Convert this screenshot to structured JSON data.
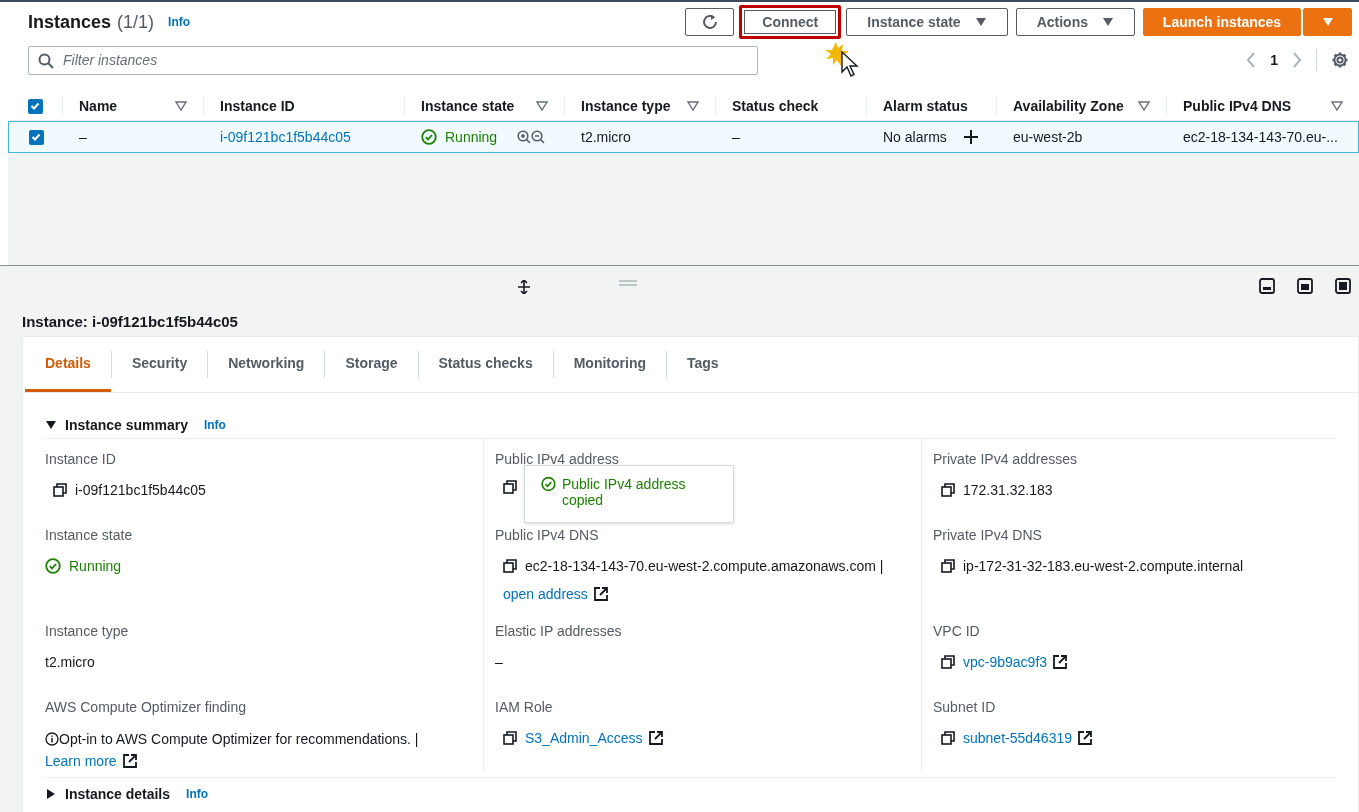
{
  "header": {
    "title": "Instances",
    "count": "(1/1)",
    "info": "Info"
  },
  "toolbar": [
    {
      "kind": "refresh",
      "highlighted": false
    },
    {
      "kind": "normal",
      "label": "Connect",
      "dropdown": false,
      "highlighted": true
    },
    {
      "kind": "normal",
      "label": "Instance state",
      "dropdown": true,
      "highlighted": false
    },
    {
      "kind": "normal",
      "label": "Actions",
      "dropdown": true,
      "highlighted": false
    },
    {
      "kind": "primary",
      "label": "Launch instances",
      "dropdown": false,
      "highlighted": false
    },
    {
      "kind": "primary_caret",
      "highlighted": false
    }
  ],
  "filter": {
    "placeholder": "Filter instances"
  },
  "pagination": {
    "page": "1"
  },
  "table": {
    "all_selected": true,
    "columns": [
      {
        "label": "Name",
        "sortable": true
      },
      {
        "label": "Instance ID",
        "sortable": false
      },
      {
        "label": "Instance state",
        "sortable": true
      },
      {
        "label": "Instance type",
        "sortable": true
      },
      {
        "label": "Status check",
        "sortable": false
      },
      {
        "label": "Alarm status",
        "sortable": false
      },
      {
        "label": "Availability Zone",
        "sortable": true
      },
      {
        "label": "Public IPv4 DNS",
        "sortable": true
      }
    ],
    "rows": [
      {
        "selected": true,
        "cells": [
          {
            "kind": "text",
            "text": "–"
          },
          {
            "kind": "link",
            "text": "i-09f121bc1f5b44c05"
          },
          {
            "kind": "status",
            "text": "Running"
          },
          {
            "kind": "text",
            "text": "t2.micro"
          },
          {
            "kind": "text",
            "text": "–"
          },
          {
            "kind": "alarm",
            "text": "No alarms"
          },
          {
            "kind": "text",
            "text": "eu-west-2b"
          },
          {
            "kind": "text",
            "text": "ec2-18-134-143-70.eu-..."
          }
        ]
      }
    ]
  },
  "details": {
    "title": "Instance: i-09f121bc1f5b44c05",
    "tabs": [
      {
        "label": "Details",
        "selected": true
      },
      {
        "label": "Security",
        "selected": false
      },
      {
        "label": "Networking",
        "selected": false
      },
      {
        "label": "Storage",
        "selected": false
      },
      {
        "label": "Status checks",
        "selected": false
      },
      {
        "label": "Monitoring",
        "selected": false
      },
      {
        "label": "Tags",
        "selected": false
      }
    ],
    "summary": {
      "title": "Instance summary",
      "info": "Info",
      "expanded": true
    },
    "fields": [
      {
        "label": "Instance ID",
        "kind": "copy",
        "text": "i-09f121bc1f5b44c05"
      },
      {
        "label": "Public IPv4 address",
        "kind": "copy",
        "tooltip": "Public IPv4 address copied"
      },
      {
        "label": "Private IPv4 addresses",
        "kind": "copy",
        "text": "172.31.32.183"
      },
      {
        "label": "Instance state",
        "kind": "status",
        "text": "Running"
      },
      {
        "label": "Public IPv4 DNS",
        "kind": "copy",
        "text": "ec2-18-134-143-70.eu-west-2.compute.amazonaws.com |",
        "link": "open address"
      },
      {
        "label": "Private IPv4 DNS",
        "kind": "copy",
        "text": "ip-172-31-32-183.eu-west-2.compute.internal"
      },
      {
        "label": "Instance type",
        "kind": "plain",
        "text": "t2.micro"
      },
      {
        "label": "Elastic IP addresses",
        "kind": "plain",
        "text": "–"
      },
      {
        "label": "VPC ID",
        "kind": "copy",
        "link": "vpc-9b9ac9f3"
      },
      {
        "label": "AWS Compute Optimizer finding",
        "kind": "info",
        "text": "Opt-in to AWS Compute Optimizer for recommendations. |",
        "link": "Learn more"
      },
      {
        "label": "IAM Role",
        "kind": "copy",
        "link": "S3_Admin_Access"
      },
      {
        "label": "Subnet ID",
        "kind": "copy",
        "link": "subnet-55d46319"
      }
    ],
    "next_section": {
      "title": "Instance details",
      "info": "Info",
      "expanded": false
    }
  }
}
